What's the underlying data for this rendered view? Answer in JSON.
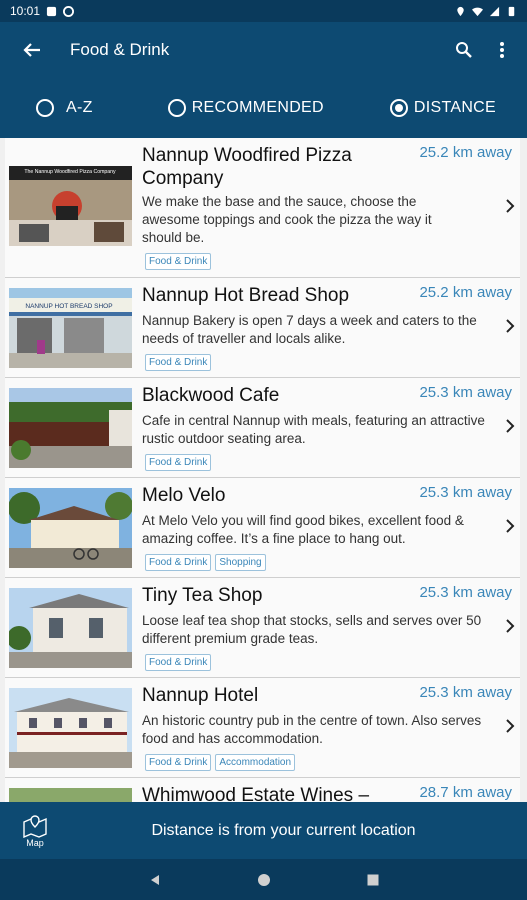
{
  "status_bar": {
    "time": "10:01"
  },
  "app_bar": {
    "title": "Food & Drink",
    "back_icon": "arrow-left-icon",
    "search_icon": "search-icon",
    "more_icon": "more-vert-icon"
  },
  "sort": {
    "options": [
      {
        "label": "A-Z",
        "selected": false
      },
      {
        "label": "RECOMMENDED",
        "selected": false
      },
      {
        "label": "DISTANCE",
        "selected": true
      }
    ]
  },
  "listings": [
    {
      "name": "Nannup Woodfired Pizza Company",
      "distance": "25.2 km away",
      "description": "We make the base and the sauce, choose the awesome toppings and cook the pizza the way it should be.",
      "tags": [
        "Food & Drink"
      ],
      "photo_sign": "The Nannup Woodfired Pizza Company"
    },
    {
      "name": "Nannup Hot Bread Shop",
      "distance": "25.2 km away",
      "description": "Nannup Bakery is open 7 days a week and caters to the needs of traveller and locals alike.",
      "tags": [
        "Food & Drink"
      ],
      "photo_sign": "NANNUP HOT BREAD SHOP"
    },
    {
      "name": "Blackwood Cafe",
      "distance": "25.3 km away",
      "description": "Cafe in central Nannup with meals, featuring an attractive rustic outdoor seating area.",
      "tags": [
        "Food & Drink"
      ]
    },
    {
      "name": "Melo Velo",
      "distance": "25.3 km away",
      "description": "At Melo Velo you will find good bikes, excellent food & amazing coffee. It’s a fine place to hang out.",
      "tags": [
        "Food & Drink",
        "Shopping"
      ]
    },
    {
      "name": "Tiny Tea Shop",
      "distance": "25.3 km away",
      "description": "Loose leaf tea shop that stocks, sells and serves over 50 different premium grade teas.",
      "tags": [
        "Food & Drink"
      ]
    },
    {
      "name": "Nannup Hotel",
      "distance": "25.3 km away",
      "description": "An historic country pub in the centre of town. Also serves food and has accommodation.",
      "tags": [
        "Food & Drink",
        "Accommodation"
      ]
    },
    {
      "name": "Whimwood Estate Wines –",
      "distance": "28.7 km away",
      "description": "",
      "tags": []
    }
  ],
  "bottom_bar": {
    "map_label": "Map",
    "info_text": "Distance is from your current location"
  },
  "colors": {
    "primary": "#0d4a72",
    "status": "#0a3a5c",
    "accent": "#3a86b8"
  }
}
